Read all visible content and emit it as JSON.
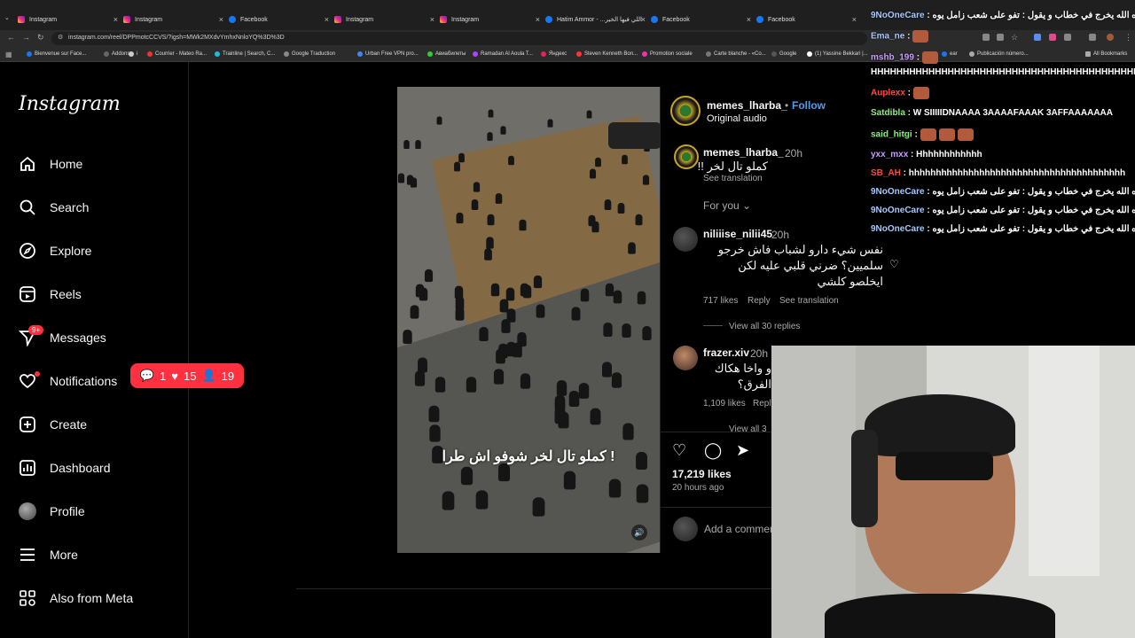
{
  "browser": {
    "tabs": [
      {
        "title": "Instagram",
        "type": "ig"
      },
      {
        "title": "Instagram",
        "type": "ig"
      },
      {
        "title": "Facebook",
        "type": "fb"
      },
      {
        "title": "Instagram",
        "type": "ig"
      },
      {
        "title": "Instagram",
        "type": "ig"
      },
      {
        "title": "Hatim Ammor - ...اللي فيها الخير",
        "type": "fb"
      },
      {
        "title": "Facebook",
        "type": "fb"
      },
      {
        "title": "Facebook",
        "type": "fb"
      }
    ],
    "tab_close": "×",
    "url": "instagram.com/reel/DPPmotcCCVS/?igsh=MWk2MXdvYmhxNnloYQ%3D%3D",
    "bookmarks": [
      "Bienvenue sur Face...",
      "Addons",
      "i",
      "Courrier - Mateo Ra...",
      "Trainline | Search, C...",
      "Google Traduction",
      "Urban Free VPN pro...",
      "Авиабилеты",
      "Ramadan Al Aoula T...",
      "Яндекс",
      "Steven Kenneth Bon...",
      "Promotion sociale",
      "Carte blanche - «Co...",
      "Google",
      "(1) Yassine Bekkari |...",
      "ear",
      "Publicación número..."
    ],
    "all_bookmarks": "All Bookmarks"
  },
  "sidebar": {
    "logo": "Instagram",
    "items": [
      {
        "label": "Home",
        "icon": "home-icon"
      },
      {
        "label": "Search",
        "icon": "search-icon"
      },
      {
        "label": "Explore",
        "icon": "compass-icon"
      },
      {
        "label": "Reels",
        "icon": "reels-icon"
      },
      {
        "label": "Messages",
        "icon": "messenger-icon"
      },
      {
        "label": "Notifications",
        "icon": "heart-icon"
      },
      {
        "label": "Create",
        "icon": "plus-square-icon"
      },
      {
        "label": "Dashboard",
        "icon": "dashboard-icon"
      },
      {
        "label": "Profile",
        "icon": "avatar"
      },
      {
        "label": "More",
        "icon": "menu-icon"
      },
      {
        "label": "Also from Meta",
        "icon": "meta-icon"
      }
    ],
    "messages_badge": "9+",
    "notif_pill": {
      "comments": "1",
      "likes": "15",
      "follows": "19"
    }
  },
  "post": {
    "username": "memes_lharba_",
    "follow": "Follow",
    "sep": "•",
    "audio": "Original audio",
    "caption_overlay": "كملو تال لخر شوفو اش طرا !",
    "likes": "17,219 likes",
    "time": "20 hours ago",
    "add_comment": "Add a comment…",
    "caption": {
      "user": "memes_lharba_",
      "time": "20h",
      "text": "كملو تال لخر !!",
      "translate": "See translation"
    },
    "for_you": "For you",
    "comments": [
      {
        "user": "niliiise_nilii45",
        "time": "20h",
        "lines": [
          "نفس شيء دارو لشباب فاش خرجو",
          "سلميين؟ ضرني قلبي عليه لكن",
          "ايخلصو كلشي"
        ],
        "likes": "717 likes",
        "reply": "Reply",
        "translate": "See translation",
        "view_replies": "View all 30 replies"
      },
      {
        "user": "frazer.xiv",
        "time": "20h",
        "lines": [
          "و واخا هكاك",
          "الفرق؟"
        ],
        "likes": "1,109 likes",
        "reply": "Reply",
        "view_replies": "View all 3"
      }
    ]
  },
  "chat": [
    {
      "user": "9NoOneCare",
      "color": "#a6c8ff",
      "text": "تصره الله يخرج في خطاب و يقول : تفو على شعب زامل يوه"
    },
    {
      "user": "Ema_ne",
      "color": "#a6c8ff",
      "text": ""
    },
    {
      "user": "mshb_199",
      "color": "#c79bff",
      "text": ""
    },
    {
      "user": "",
      "color": "#ffffff",
      "text": "HHHHHHHHHHHHHHHHHHHHHHHHHHHHHHHHHHHHHHHHHHH"
    },
    {
      "user": "Auplexx",
      "color": "#ff4a3a",
      "text": ""
    },
    {
      "user": "Satdibla",
      "color": "#8af07a",
      "text": "W SIIIIIDNAAAA 3AAAAFAAAK 3AFFAAAAAAA"
    },
    {
      "user": "said_hitgi",
      "color": "#8af07a",
      "text": ""
    },
    {
      "user": "yxx_mxx",
      "color": "#c79bff",
      "text": "Hhhhhhhhhhhh"
    },
    {
      "user": "SB_AH",
      "color": "#ff4a3a",
      "text": "hhhhhhhhhhhhhhhhhhhhhhhhhhhhhhhhhhhhhhhh"
    },
    {
      "user": "9NoOneCare",
      "color": "#a6c8ff",
      "text": "تصره الله يخرج في خطاب و يقول : تفو على شعب زامل يوه"
    },
    {
      "user": "9NoOneCare",
      "color": "#a6c8ff",
      "text": "تصره الله يخرج في خطاب و يقول : تفو على شعب زامل يوه"
    },
    {
      "user": "9NoOneCare",
      "color": "#a6c8ff",
      "text": "حمد تصره الله يخرج في خطاب و يقول : تفو على شعب زامل يوه"
    }
  ]
}
